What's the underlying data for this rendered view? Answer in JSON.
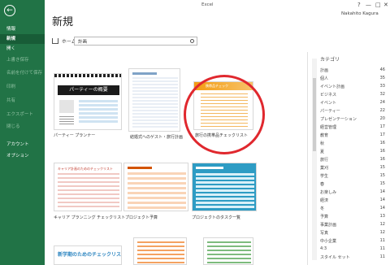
{
  "window": {
    "title": "Excel",
    "user": "Nakahito Kagura",
    "help": "?",
    "minimize": "—",
    "restore": "□",
    "close": "✕"
  },
  "sidebar": {
    "back": "←",
    "items": [
      {
        "label": "情報",
        "dim": false,
        "selected": false
      },
      {
        "label": "新規",
        "dim": false,
        "selected": true
      },
      {
        "label": "開く",
        "dim": false,
        "selected": false
      },
      {
        "label": "上書き保存",
        "dim": true,
        "selected": false
      },
      {
        "label": "名前を付けて保存",
        "dim": true,
        "selected": false
      },
      {
        "label": "印刷",
        "dim": true,
        "selected": false
      },
      {
        "label": "共有",
        "dim": true,
        "selected": false
      },
      {
        "label": "エクスポート",
        "dim": true,
        "selected": false
      },
      {
        "label": "閉じる",
        "dim": true,
        "selected": false
      },
      {
        "label": "アカウント",
        "dim": false,
        "selected": false
      },
      {
        "label": "オプション",
        "dim": false,
        "selected": false
      }
    ]
  },
  "main": {
    "title": "新規",
    "home": "ホーム",
    "search_value": "計画"
  },
  "templates": [
    {
      "label": "パーティー プランナー",
      "heading": "パーティーの概要"
    },
    {
      "label": "結婚式へのゲスト・旅行計画"
    },
    {
      "label": "旅行の携帯品チェックリスト",
      "heading": "携帯品チェック"
    },
    {
      "label": "キャリア プランニング チェックリスト",
      "heading": "キャリア計画のためのチェックリスト"
    },
    {
      "label": "プロジェクト予算"
    },
    {
      "label": "プロジェクトのタスク一覧"
    },
    {
      "label": "",
      "heading": "新学期のためのチェックリスト"
    },
    {
      "label": ""
    },
    {
      "label": ""
    }
  ],
  "categories": {
    "header": "カテゴリ",
    "items": [
      {
        "name": "計画",
        "count": "46"
      },
      {
        "name": "個人",
        "count": "35"
      },
      {
        "name": "イベント計画",
        "count": "33"
      },
      {
        "name": "ビジネス",
        "count": "32"
      },
      {
        "name": "イベント",
        "count": "24"
      },
      {
        "name": "パーティー",
        "count": "22"
      },
      {
        "name": "プレゼンテーション",
        "count": "20"
      },
      {
        "name": "経営管理",
        "count": "17"
      },
      {
        "name": "教育",
        "count": "17"
      },
      {
        "name": "秋",
        "count": "16"
      },
      {
        "name": "夏",
        "count": "16"
      },
      {
        "name": "旅行",
        "count": "16"
      },
      {
        "name": "業刈",
        "count": "15"
      },
      {
        "name": "学生",
        "count": "15"
      },
      {
        "name": "春",
        "count": "15"
      },
      {
        "name": "お楽しみ",
        "count": "14"
      },
      {
        "name": "経済",
        "count": "14"
      },
      {
        "name": "冬",
        "count": "14"
      },
      {
        "name": "予算",
        "count": "13"
      },
      {
        "name": "事業計画",
        "count": "12"
      },
      {
        "name": "写真",
        "count": "12"
      },
      {
        "name": "中小企業",
        "count": "11"
      },
      {
        "name": "4:3",
        "count": "11"
      },
      {
        "name": "スタイル セット",
        "count": "11"
      }
    ]
  },
  "colors": {
    "sidebar": "#217346",
    "sidebar_selected": "#185c37",
    "accent_orange": "#f39c12",
    "accent_teal": "#2e9cc4",
    "annotation_circle": "#e0282e"
  }
}
